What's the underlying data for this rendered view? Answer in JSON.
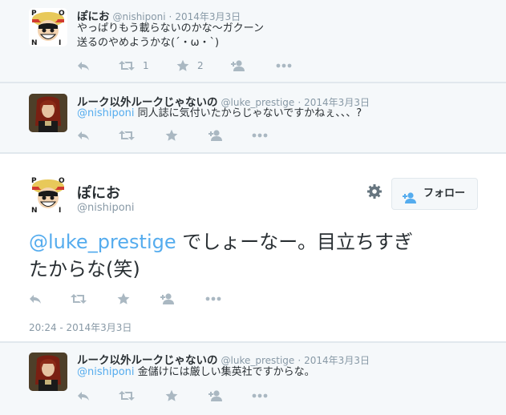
{
  "tweets": {
    "t1": {
      "name": "ぽにお",
      "handle": "@nishiponi",
      "sep": "·",
      "date": "2014年3月3日",
      "line1": "やっぱりもう載らないのかな〜ガクーン",
      "line2": "送るのやめようかな(´・ω・`)",
      "retweet_count": "1",
      "favorite_count": "2"
    },
    "t2": {
      "name": "ルーク以外ルークじゃないの",
      "handle": "@luke_prestige",
      "sep": "·",
      "date": "2014年3月3日",
      "mention": "@nishiponi",
      "text": " 同人誌に気付いたからじゃないですかねぇ、、、?"
    },
    "main": {
      "name": "ぽにお",
      "handle": "@nishiponi",
      "mention": "@luke_prestige",
      "text_line1": " でしょーなー。目立ちすぎ",
      "text_line2": "たからな(笑)",
      "follow_label": "フォロー",
      "timestamp": "20:24 - 2014年3月3日"
    },
    "t4": {
      "name": "ルーク以外ルークじゃないの",
      "handle": "@luke_prestige",
      "sep": "·",
      "date": "2014年3月3日",
      "mention": "@nishiponi",
      "text": " 金儲けには厳しい集英社ですからな。"
    }
  },
  "icons": {
    "reply": "reply-icon",
    "retweet": "retweet-icon",
    "favorite": "star-icon",
    "follow": "follow-icon",
    "more": "more-icon",
    "settings": "gear-icon"
  },
  "colors": {
    "link": "#55acee",
    "muted": "#8899a6",
    "icon": "#aab8c2",
    "text": "#292f33",
    "conversation_bg": "#f5f8fa"
  }
}
